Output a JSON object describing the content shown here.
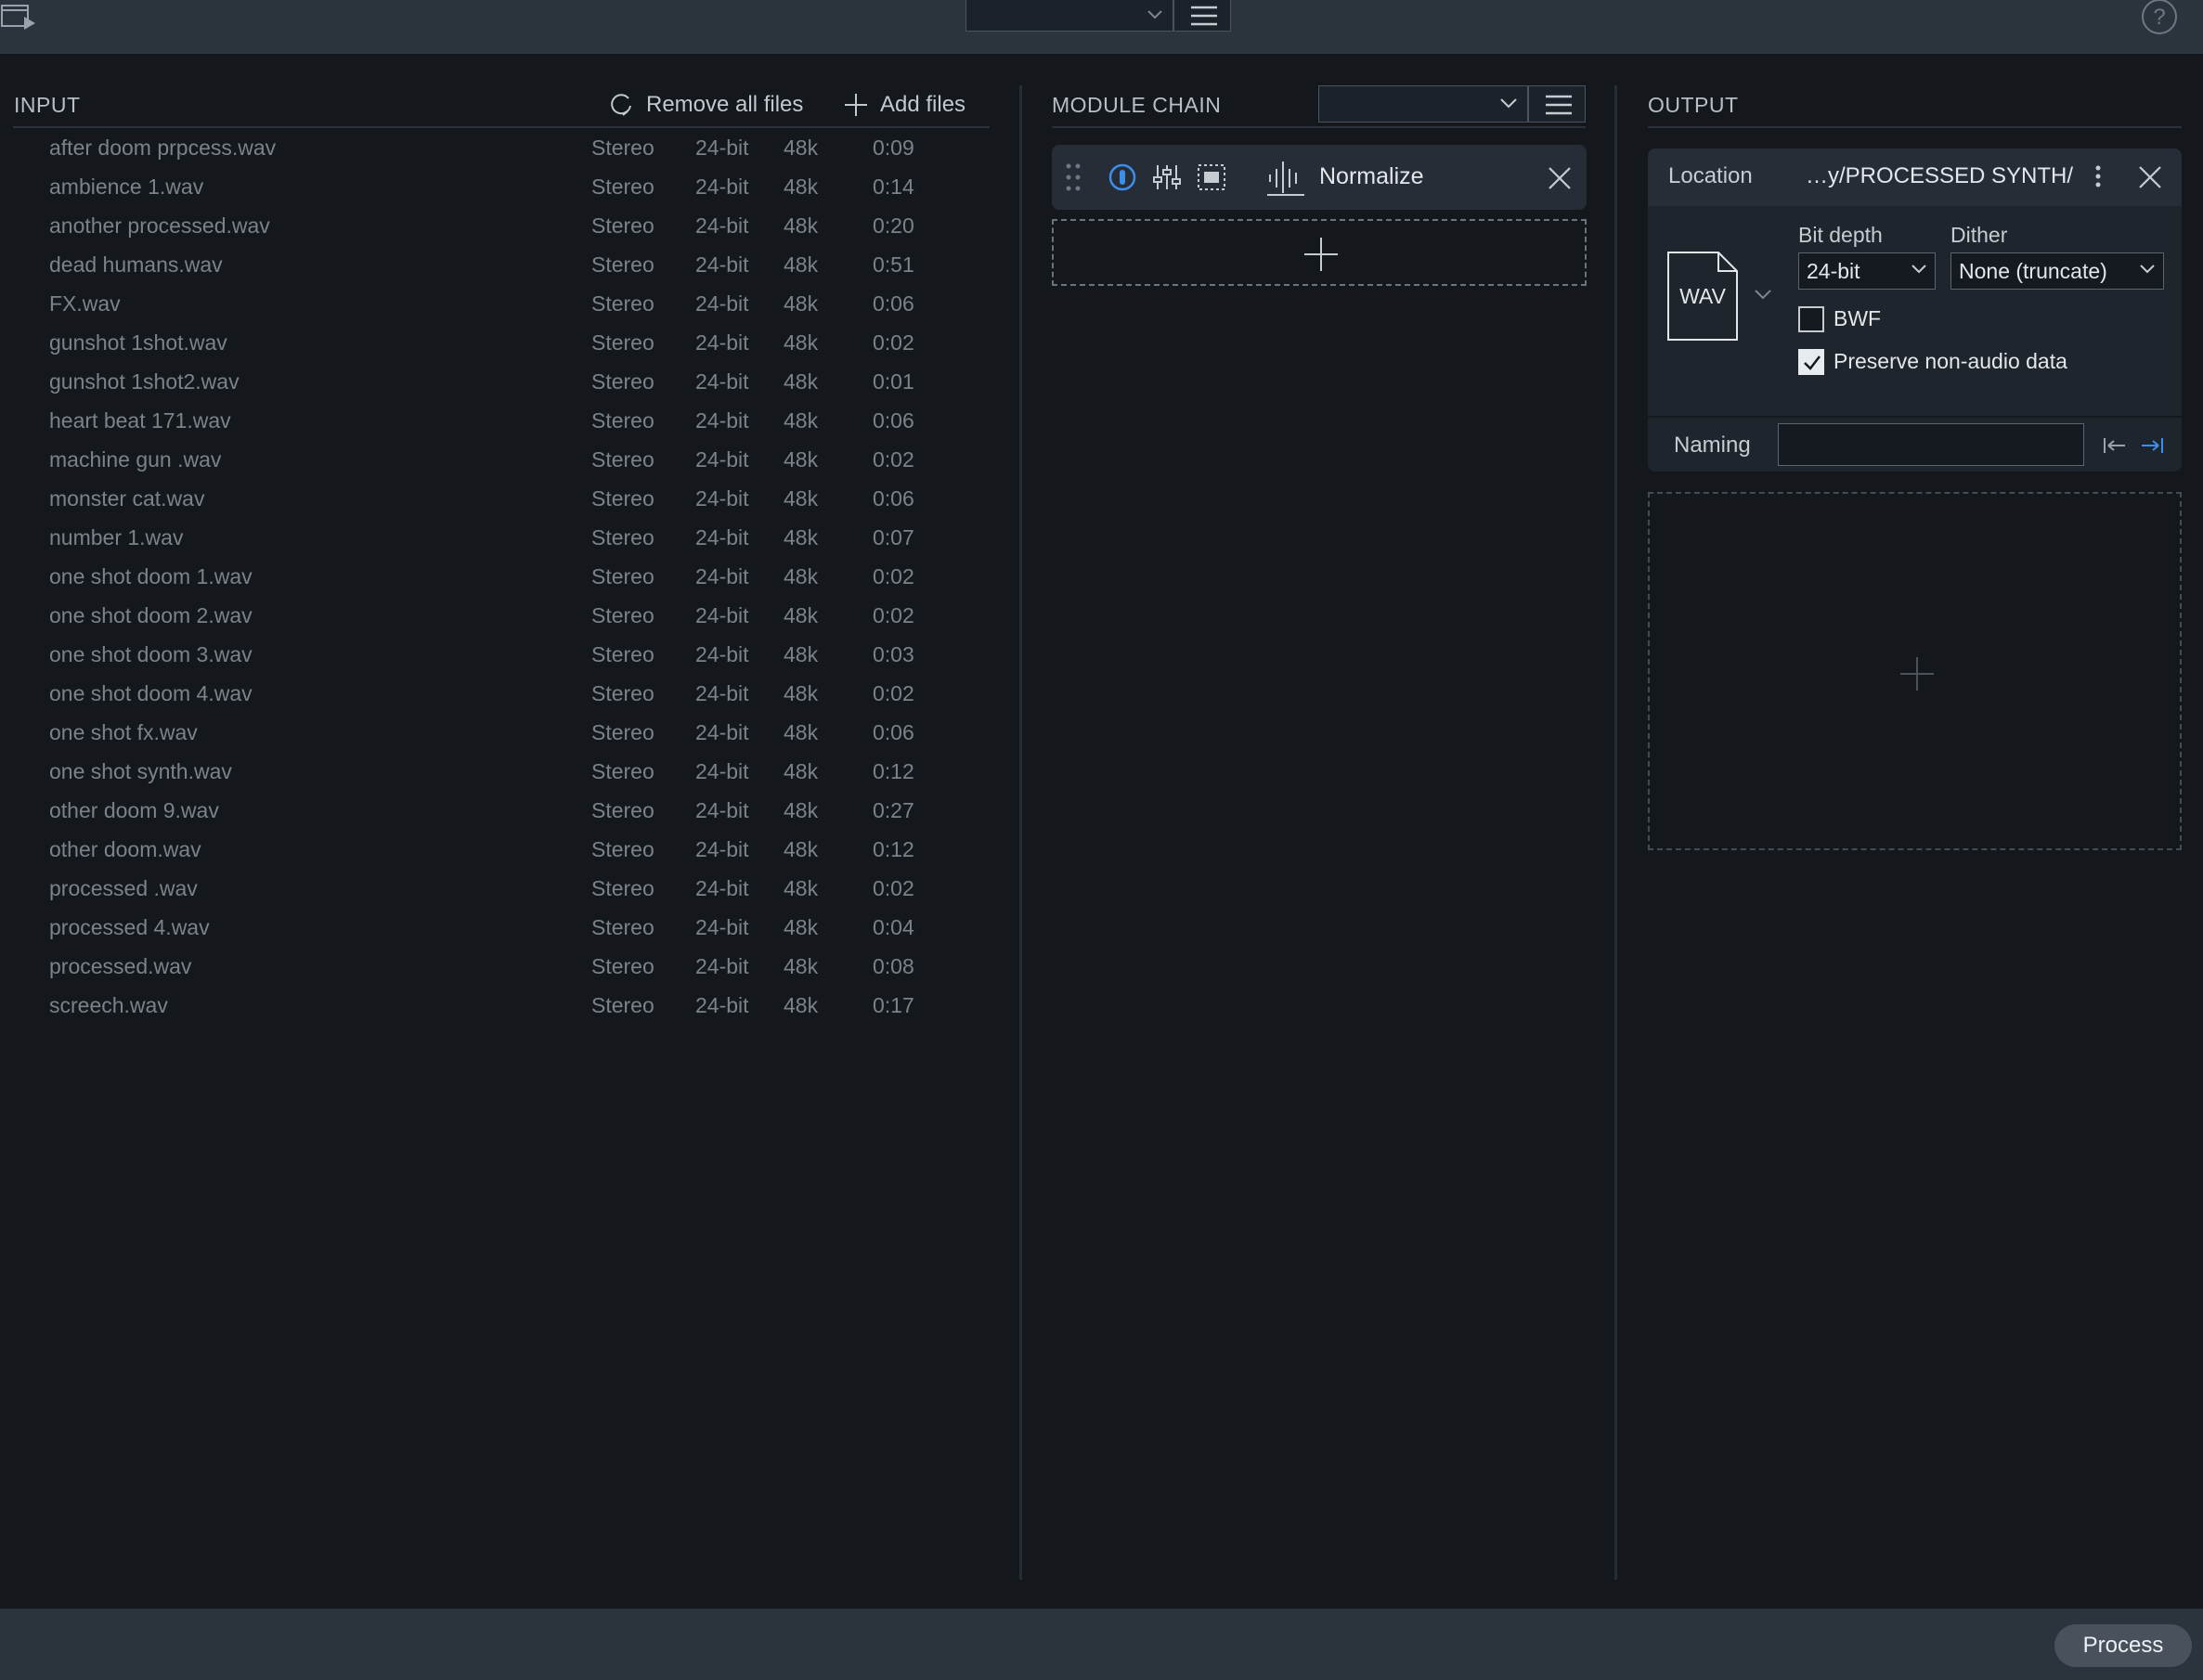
{
  "topbar": {
    "preset_value": "",
    "icons": [
      "batch-window-icon",
      "chevron-down-icon",
      "hamburger-menu-icon",
      "help-icon"
    ]
  },
  "input": {
    "title": "INPUT",
    "remove_all_label": "Remove all files",
    "add_files_label": "Add files",
    "files": [
      {
        "name": "after doom prpcess.wav",
        "channels": "Stereo",
        "bit_depth": "24-bit",
        "sample_rate": "48k",
        "duration": "0:09"
      },
      {
        "name": "ambience 1.wav",
        "channels": "Stereo",
        "bit_depth": "24-bit",
        "sample_rate": "48k",
        "duration": "0:14"
      },
      {
        "name": "another processed.wav",
        "channels": "Stereo",
        "bit_depth": "24-bit",
        "sample_rate": "48k",
        "duration": "0:20"
      },
      {
        "name": "dead humans.wav",
        "channels": "Stereo",
        "bit_depth": "24-bit",
        "sample_rate": "48k",
        "duration": "0:51"
      },
      {
        "name": "FX.wav",
        "channels": "Stereo",
        "bit_depth": "24-bit",
        "sample_rate": "48k",
        "duration": "0:06"
      },
      {
        "name": "gunshot 1shot.wav",
        "channels": "Stereo",
        "bit_depth": "24-bit",
        "sample_rate": "48k",
        "duration": "0:02"
      },
      {
        "name": "gunshot 1shot2.wav",
        "channels": "Stereo",
        "bit_depth": "24-bit",
        "sample_rate": "48k",
        "duration": "0:01"
      },
      {
        "name": "heart beat 171.wav",
        "channels": "Stereo",
        "bit_depth": "24-bit",
        "sample_rate": "48k",
        "duration": "0:06"
      },
      {
        "name": "machine gun .wav",
        "channels": "Stereo",
        "bit_depth": "24-bit",
        "sample_rate": "48k",
        "duration": "0:02"
      },
      {
        "name": "monster cat.wav",
        "channels": "Stereo",
        "bit_depth": "24-bit",
        "sample_rate": "48k",
        "duration": "0:06"
      },
      {
        "name": "number 1.wav",
        "channels": "Stereo",
        "bit_depth": "24-bit",
        "sample_rate": "48k",
        "duration": "0:07"
      },
      {
        "name": "one shot doom 1.wav",
        "channels": "Stereo",
        "bit_depth": "24-bit",
        "sample_rate": "48k",
        "duration": "0:02"
      },
      {
        "name": "one shot doom 2.wav",
        "channels": "Stereo",
        "bit_depth": "24-bit",
        "sample_rate": "48k",
        "duration": "0:02"
      },
      {
        "name": "one shot doom 3.wav",
        "channels": "Stereo",
        "bit_depth": "24-bit",
        "sample_rate": "48k",
        "duration": "0:03"
      },
      {
        "name": "one shot doom 4.wav",
        "channels": "Stereo",
        "bit_depth": "24-bit",
        "sample_rate": "48k",
        "duration": "0:02"
      },
      {
        "name": "one shot fx.wav",
        "channels": "Stereo",
        "bit_depth": "24-bit",
        "sample_rate": "48k",
        "duration": "0:06"
      },
      {
        "name": "one shot synth.wav",
        "channels": "Stereo",
        "bit_depth": "24-bit",
        "sample_rate": "48k",
        "duration": "0:12"
      },
      {
        "name": "other doom 9.wav",
        "channels": "Stereo",
        "bit_depth": "24-bit",
        "sample_rate": "48k",
        "duration": "0:27"
      },
      {
        "name": "other doom.wav",
        "channels": "Stereo",
        "bit_depth": "24-bit",
        "sample_rate": "48k",
        "duration": "0:12"
      },
      {
        "name": "processed .wav",
        "channels": "Stereo",
        "bit_depth": "24-bit",
        "sample_rate": "48k",
        "duration": "0:02"
      },
      {
        "name": "processed 4.wav",
        "channels": "Stereo",
        "bit_depth": "24-bit",
        "sample_rate": "48k",
        "duration": "0:04"
      },
      {
        "name": "processed.wav",
        "channels": "Stereo",
        "bit_depth": "24-bit",
        "sample_rate": "48k",
        "duration": "0:08"
      },
      {
        "name": "screech.wav",
        "channels": "Stereo",
        "bit_depth": "24-bit",
        "sample_rate": "48k",
        "duration": "0:17"
      }
    ]
  },
  "module_chain": {
    "title": "MODULE CHAIN",
    "preset_value": "",
    "modules": [
      {
        "name": "Normalize",
        "enabled": true
      }
    ]
  },
  "output": {
    "title": "OUTPUT",
    "location_label": "Location",
    "location_path": "…y/PROCESSED SYNTH/",
    "format": "WAV",
    "bit_depth_label": "Bit depth",
    "bit_depth_value": "24-bit",
    "dither_label": "Dither",
    "dither_value": "None (truncate)",
    "bwf_label": "BWF",
    "bwf_checked": false,
    "preserve_label": "Preserve non-audio data",
    "preserve_checked": true,
    "naming_label": "Naming",
    "naming_value": ""
  },
  "bottombar": {
    "process_label": "Process"
  },
  "colors": {
    "background": "#14181d",
    "bar": "#2b333d",
    "accent_blue": "#3b8eea",
    "row_text": "#7b828b"
  }
}
